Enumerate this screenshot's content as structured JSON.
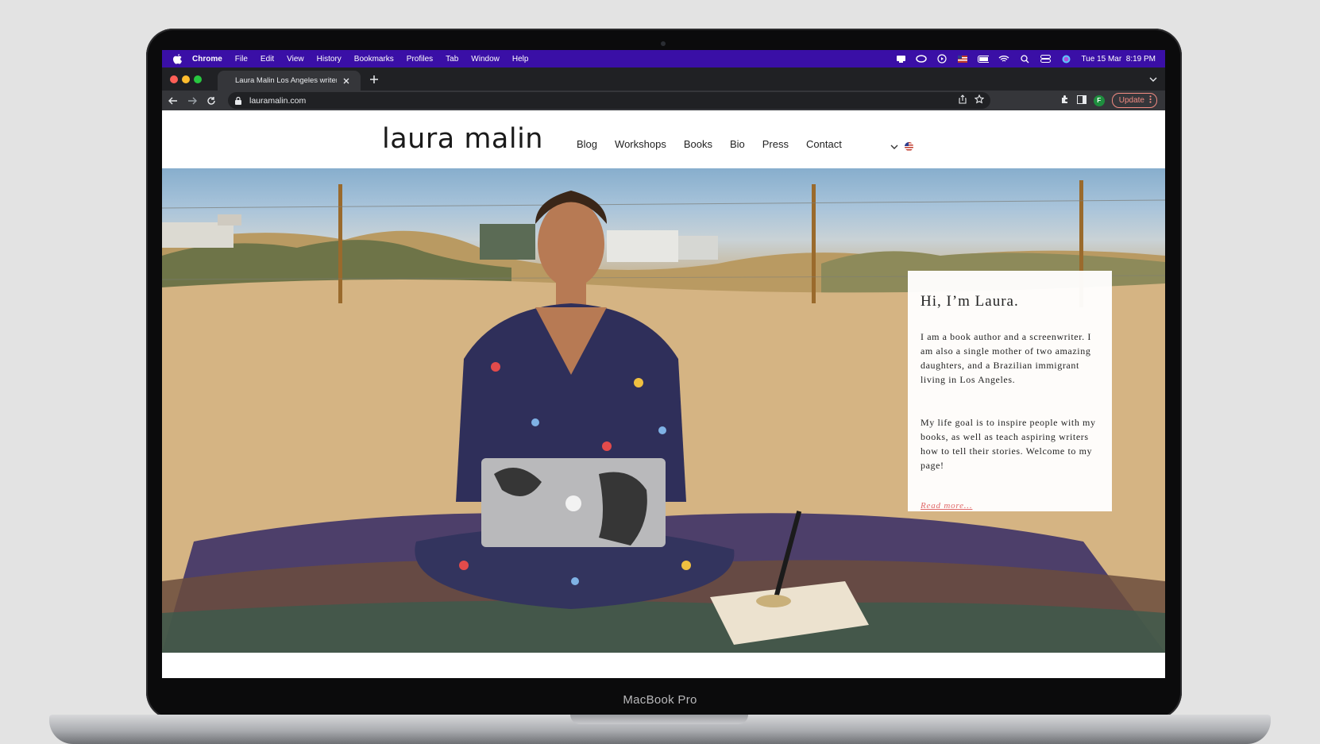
{
  "device": {
    "brand": "MacBook Pro"
  },
  "menubar": {
    "items": [
      "Chrome",
      "File",
      "Edit",
      "View",
      "History",
      "Bookmarks",
      "Profiles",
      "Tab",
      "Window",
      "Help"
    ],
    "clock": "Tue 15 Mar  8:19 PM",
    "color": "#3a0fa6"
  },
  "browser": {
    "tab_title": "Laura Malin Los Angeles writer",
    "url": "lauramalin.com",
    "update_label": "Update",
    "profile_initial": "F"
  },
  "site": {
    "logo": "laura malin",
    "nav": {
      "blog": "Blog",
      "workshops": "Workshops",
      "books": "Books",
      "bio": "Bio",
      "press": "Press",
      "contact": "Contact"
    },
    "card": {
      "heading": "Hi, I’m Laura.",
      "p1": "I am a book author and a screenwriter. I am also a single mother of two amazing daughters, and a Brazilian immigrant living in Los Angeles.",
      "p2": "My life goal is to inspire people with my books, as well as teach aspiring  writers  how to tell  their stories. Welcome to my page!",
      "read_more": "Read more..."
    },
    "accent_color": "#e06a6a"
  }
}
